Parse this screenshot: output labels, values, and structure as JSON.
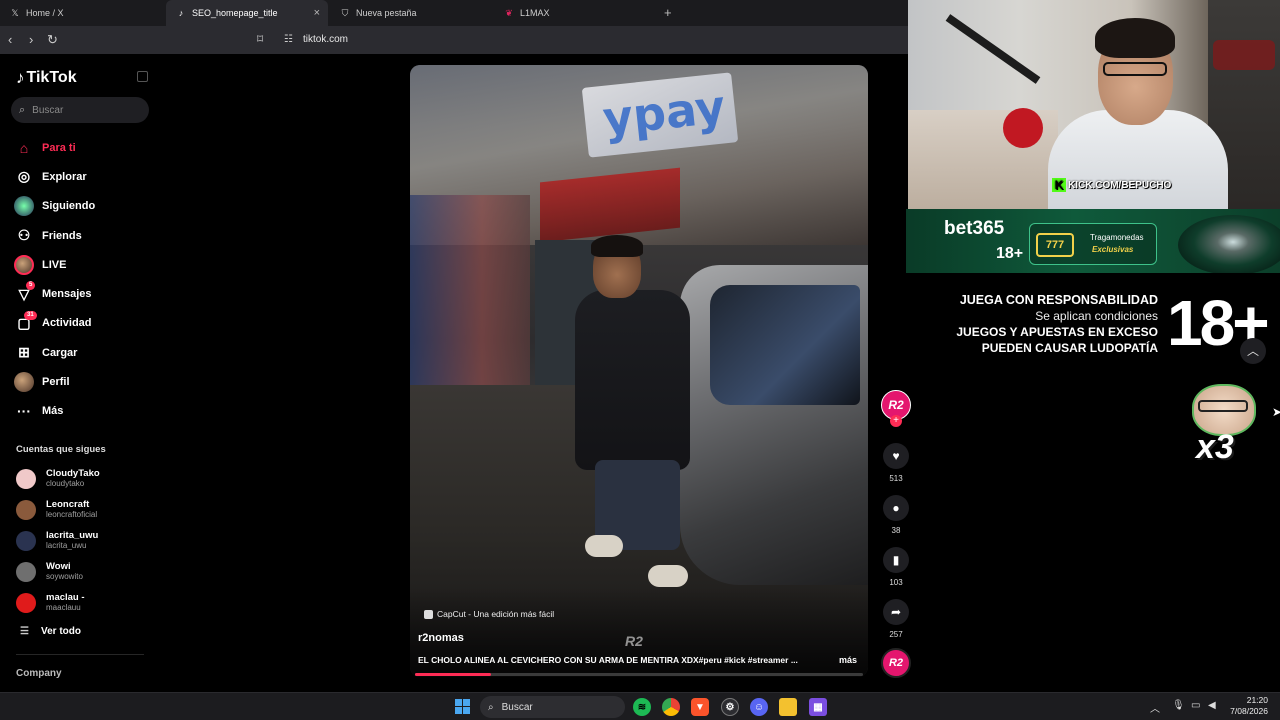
{
  "browser": {
    "tabs": [
      {
        "title": "Home / X",
        "icon": "x-logo-icon"
      },
      {
        "title": "SEO_homepage_title",
        "icon": "tiktok-icon",
        "active": true
      },
      {
        "title": "Nueva pestaña",
        "icon": "brave-shield-icon"
      },
      {
        "title": "L1MAX",
        "icon": "raspberry-icon"
      }
    ],
    "close_symbol": "×",
    "new_tab_symbol": "+",
    "url": "tiktok.com"
  },
  "sidebar": {
    "logo_text": "TikTok",
    "search_placeholder": "Buscar",
    "nav": [
      {
        "label": "Para ti",
        "icon": "home-icon",
        "active": true
      },
      {
        "label": "Explorar",
        "icon": "compass-icon"
      },
      {
        "label": "Siguiendo",
        "icon": "following-avatar-icon"
      },
      {
        "label": "Friends",
        "icon": "friends-icon"
      },
      {
        "label": "LIVE",
        "icon": "live-avatar-icon"
      },
      {
        "label": "Mensajes",
        "icon": "messages-icon",
        "badge": "5"
      },
      {
        "label": "Actividad",
        "icon": "activity-icon",
        "badge": "31"
      },
      {
        "label": "Cargar",
        "icon": "upload-icon"
      },
      {
        "label": "Perfil",
        "icon": "profile-avatar-icon"
      },
      {
        "label": "Más",
        "icon": "more-icon"
      }
    ],
    "following_title": "Cuentas que sigues",
    "following": [
      {
        "name": "CloudyTako",
        "handle": "cloudytako",
        "color": "#f0c9c9"
      },
      {
        "name": "Leoncraft",
        "handle": "leoncraftoficial",
        "color": "#8a5a3c"
      },
      {
        "name": "lacrita_uwu",
        "handle": "lacrita_uwu",
        "color": "#2a3350"
      },
      {
        "name": "Wowi",
        "handle": "soywowito",
        "color": "#6f6f6f"
      },
      {
        "name": "maclau -",
        "handle": "maaclauu",
        "color": "#e01b1b"
      }
    ],
    "see_all": "Ver todo",
    "company": "Company"
  },
  "video": {
    "sign_text": "ypay",
    "capcut": "CapCut - Una edición más fácil",
    "author": "r2nomas",
    "watermark": "R2",
    "description": "EL CHOLO ALINEA AL CEVICHERO CON SU ARMA DE MENTIRA XDX#peru #kick #streamer ...",
    "more": "más",
    "progress": 0.17
  },
  "actions": {
    "creator_initials": "R2",
    "likes": "513",
    "comments": "38",
    "saves": "103",
    "shares": "257",
    "music_initials": "R2"
  },
  "stream_overlay": {
    "kick_url": "KICK.COM/BEPUCHO",
    "banner": {
      "brand": "bet365",
      "age": "18+",
      "box_line1": "Tragamonedas",
      "box_line2": "Exclusivas",
      "slot": "777"
    },
    "responsibility": {
      "line1": "JUEGA CON RESPONSABILIDAD",
      "line2": "Se aplican condiciones",
      "line3": "JUEGOS Y APUESTAS EN EXCESO",
      "line4": "PUEDEN CAUSAR LUDOPATÍA",
      "big": "18+"
    },
    "sticker_text": "x3"
  },
  "taskbar": {
    "search": "Buscar",
    "time": "21:20",
    "date": "7/08/2026"
  }
}
